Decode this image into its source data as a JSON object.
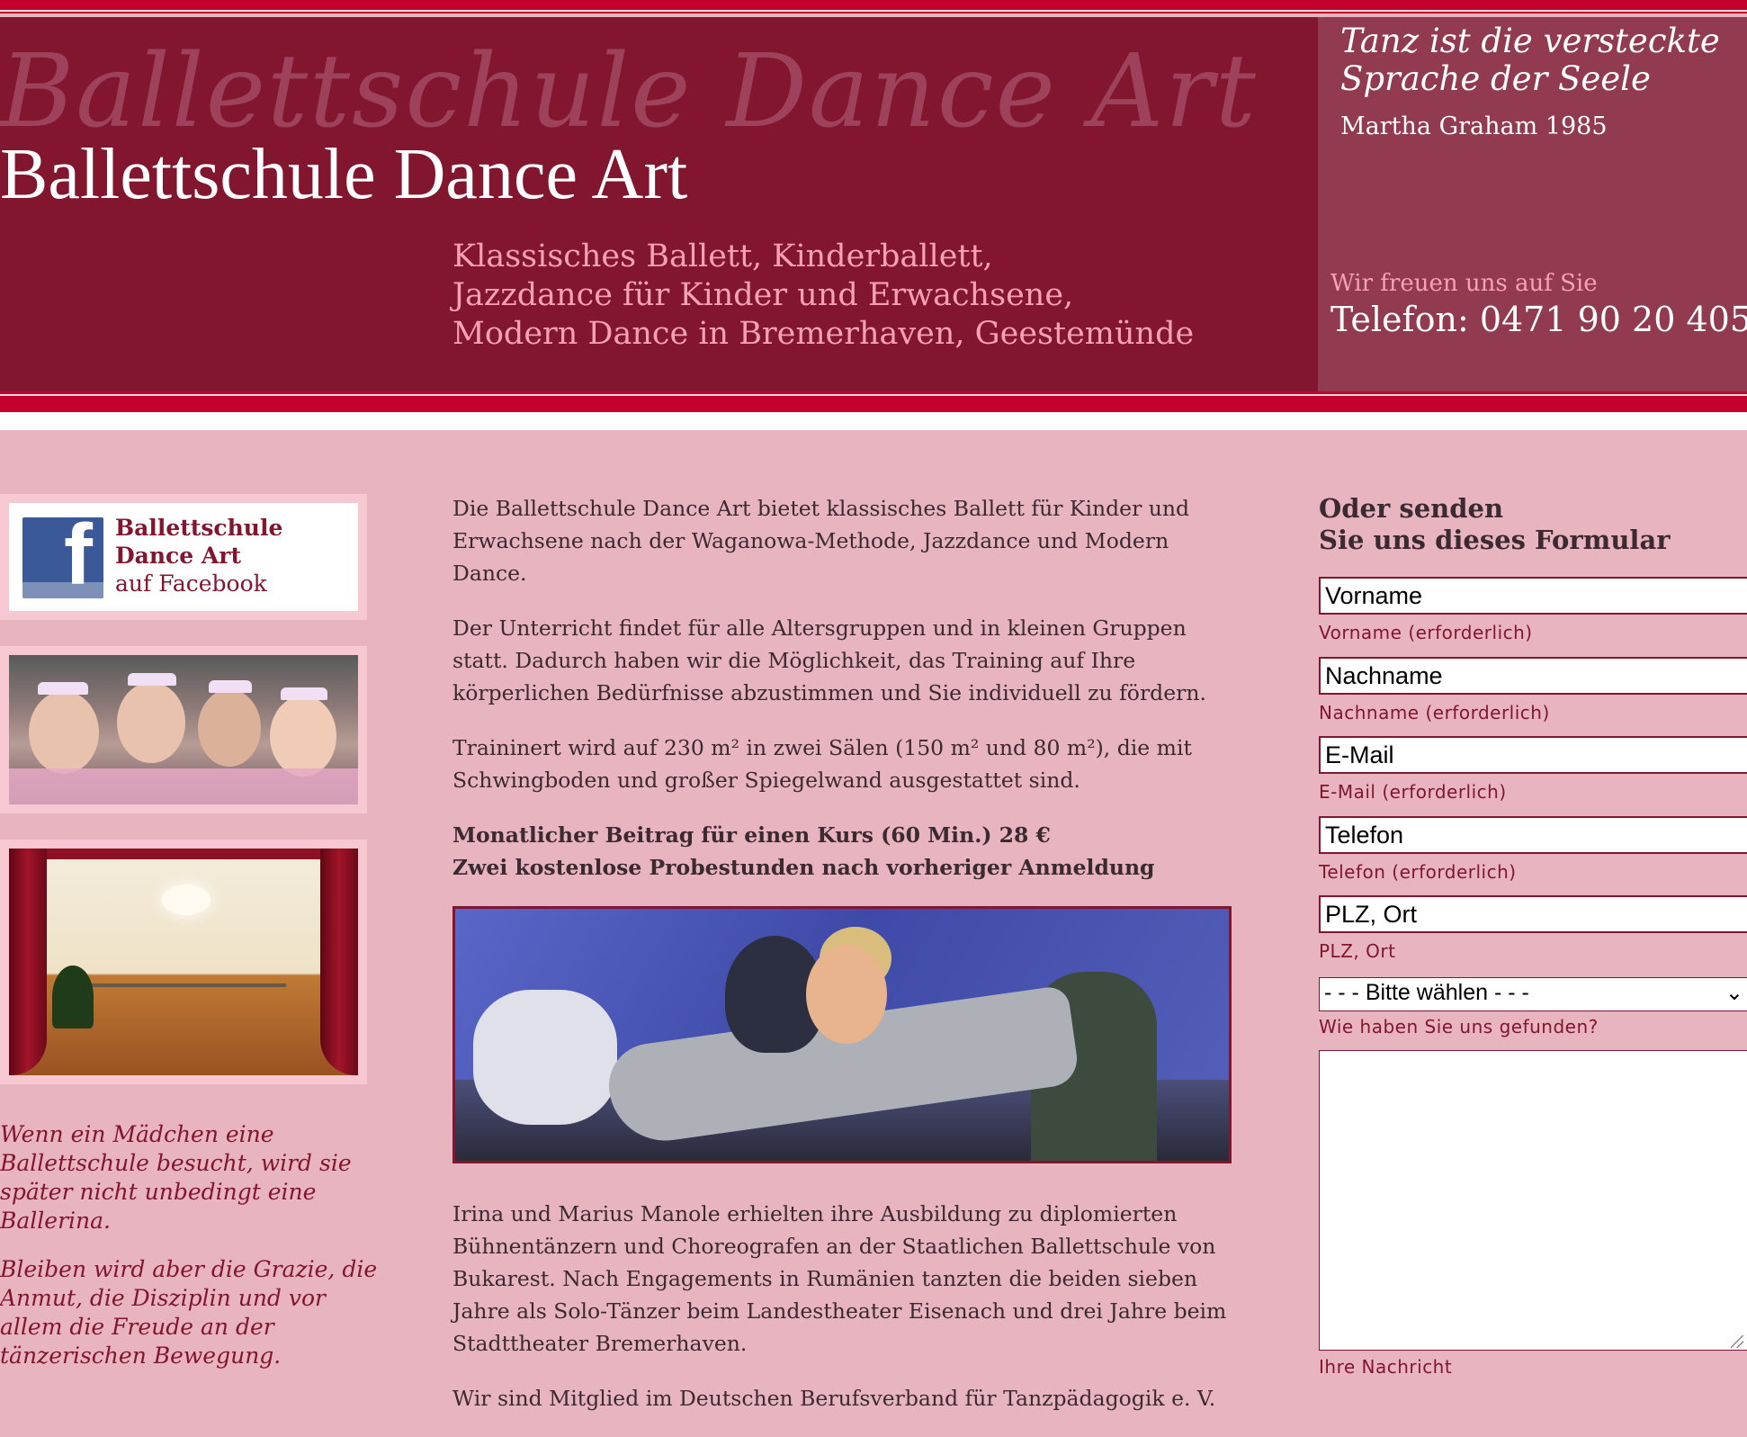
{
  "header": {
    "script_title": "Ballettschule Dance Art",
    "title": "Ballettschule Dance Art",
    "subtitle_lines": [
      "Klassisches Ballett, Kinderballett,",
      "Jazzdance für Kinder und Erwachsene,",
      "Modern Dance in Bremerhaven, Geestemünde"
    ],
    "quote_lines": [
      "Tanz ist die versteckte",
      "Sprache der Seele"
    ],
    "quote_author": "Martha Graham 1985",
    "welcome": "Wir freuen uns auf Sie",
    "phone": "Telefon: 0471 90 20 405"
  },
  "left": {
    "facebook": {
      "line1": "Ballettschule",
      "line2": "Dance Art",
      "line3": "auf Facebook",
      "logo_letter": "f"
    },
    "quote_paragraphs": [
      "Wenn ein Mädchen eine Ballettschule besucht, wird sie später nicht unbedingt eine Ballerina.",
      "Bleiben wird aber die Grazie, die Anmut, die Disziplin und vor allem die Freude an der tänzerischen Bewegung."
    ]
  },
  "main": {
    "paragraphs": [
      "Die Ballettschule Dance Art bietet klassisches Ballett für Kinder und Erwachsene nach der Waganowa-Methode, Jazzdance und Modern Dance.",
      "Der Unterricht findet für alle Altersgruppen und in kleinen Gruppen statt. Dadurch haben wir die Möglichkeit, das Training auf Ihre körperlichen Bedürfnisse abzustimmen und Sie individuell zu fördern.",
      "Traininert wird auf 230 m² in zwei Sälen (150 m² und 80 m²), die mit Schwingboden und großer Spiegelwand ausgestattet sind."
    ],
    "price_line": "Monatlicher Beitrag für einen Kurs (60 Min.) 28 €",
    "trial_line": "Zwei kostenlose Probestunden nach vorheriger Anmeldung",
    "paragraphs_after": [
      "Irina und Marius Manole erhielten ihre Ausbildung zu diplomierten Bühnentänzern und Choreografen an der Staatlichen Ballettschule von Bukarest. Nach Engagements in Rumänien tanzten die beiden sieben Jahre als Solo-Tänzer beim Landestheater Eisenach und drei Jahre beim Stadttheater Bremerhaven.",
      "Wir sind Mitglied im Deutschen Berufsverband für Tanzpädagogik e. V."
    ]
  },
  "form": {
    "title_line1": "Oder senden",
    "title_line2": "Sie uns dieses Formular",
    "fields": [
      {
        "placeholder": "Vorname",
        "label": "Vorname (erforderlich)"
      },
      {
        "placeholder": "Nachname",
        "label": "Nachname (erforderlich)"
      },
      {
        "placeholder": "E-Mail",
        "label": "E-Mail (erforderlich)"
      },
      {
        "placeholder": "Telefon",
        "label": "Telefon (erforderlich)"
      },
      {
        "placeholder": "PLZ, Ort",
        "label": "PLZ, Ort"
      }
    ],
    "select_value": "- - - Bitte wählen - - -",
    "select_label": "Wie haben Sie uns gefunden?",
    "message_label": "Ihre Nachricht",
    "chevron": "⌄"
  },
  "colors": {
    "bordeaux": "#83162f",
    "red_stripe": "#c4002c",
    "side_panel": "#913a50",
    "page_bg": "#e8b4bf",
    "accent_pink": "#f7a1b5"
  }
}
